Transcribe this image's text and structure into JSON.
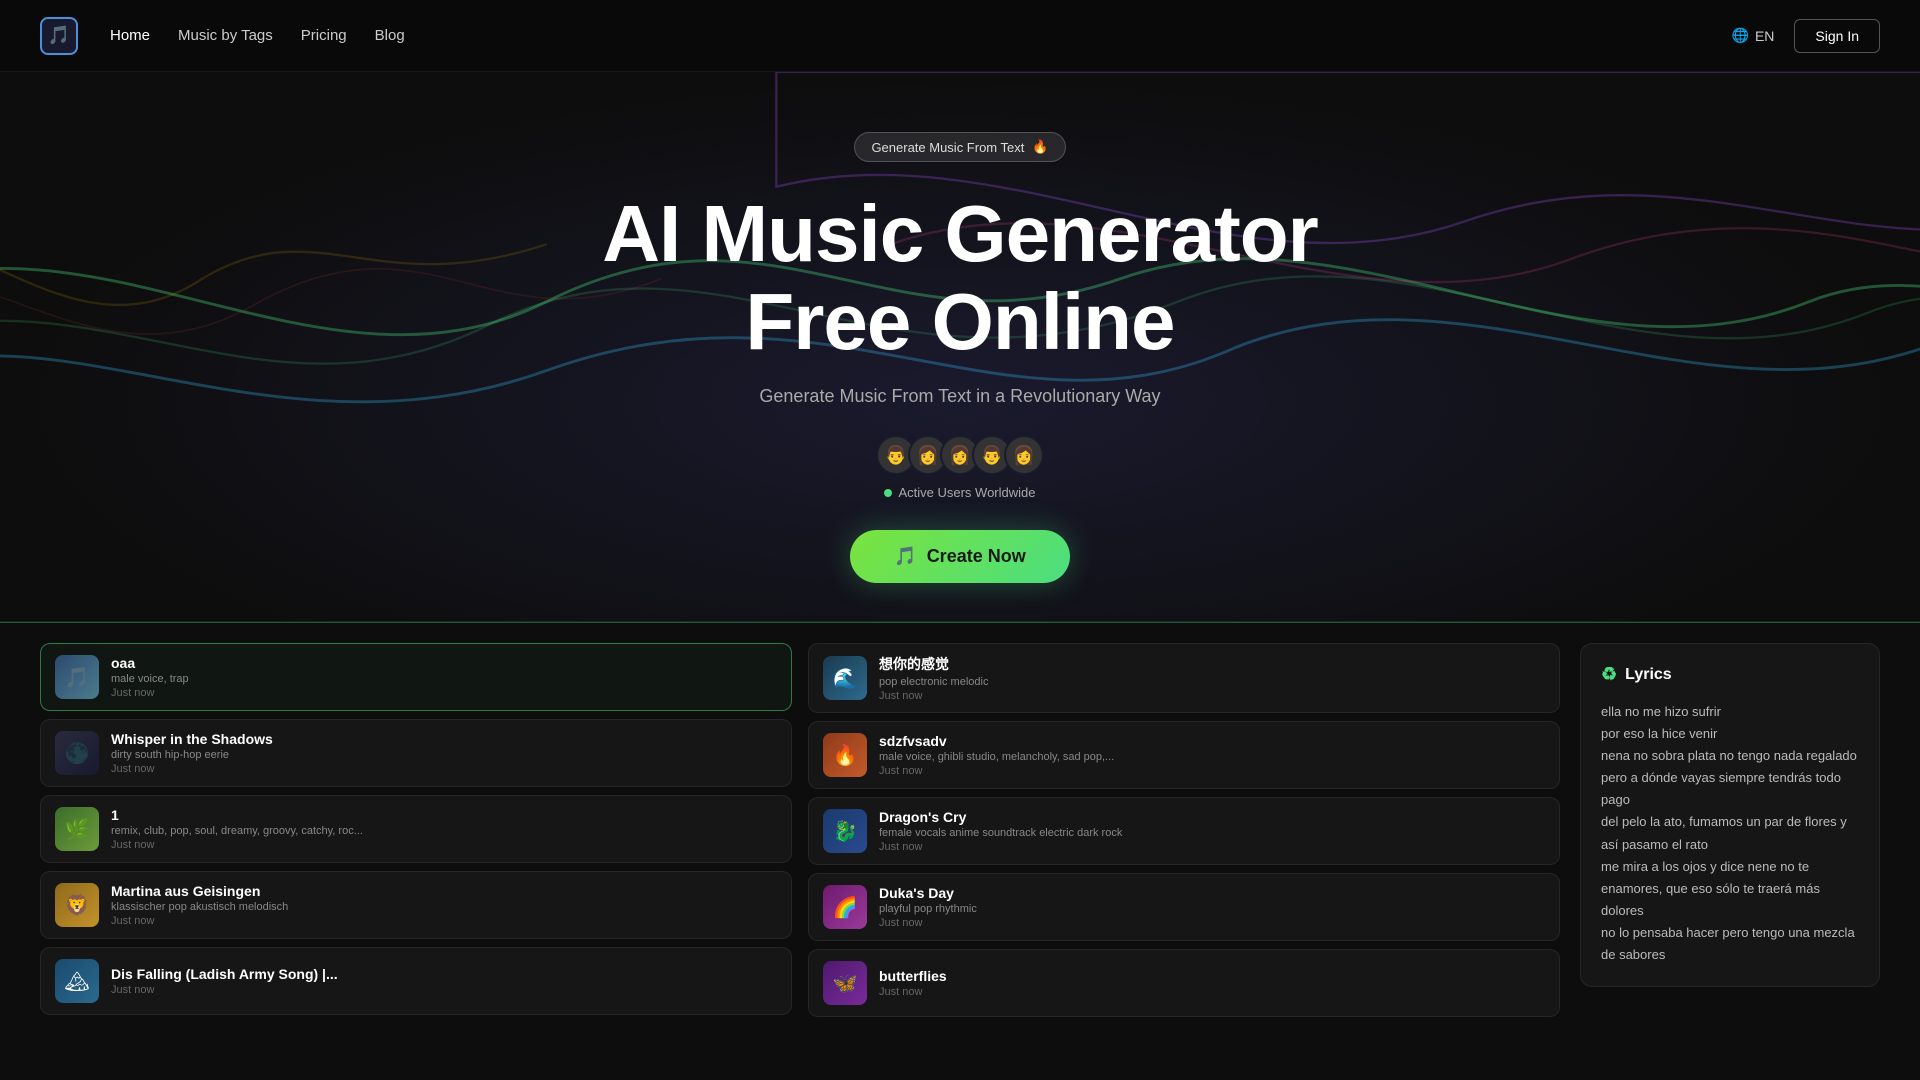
{
  "nav": {
    "logo_icon": "🎵",
    "links": [
      {
        "id": "home",
        "label": "Home",
        "active": true
      },
      {
        "id": "music-by-tags",
        "label": "Music by Tags",
        "active": false
      },
      {
        "id": "pricing",
        "label": "Pricing",
        "active": false
      },
      {
        "id": "blog",
        "label": "Blog",
        "active": false
      }
    ],
    "lang_label": "EN",
    "sign_in_label": "Sign In"
  },
  "hero": {
    "badge_text": "Generate Music From Text",
    "badge_icon": "🔥",
    "title_line1": "AI Music Generator",
    "title_line2": "Free Online",
    "subtitle": "Generate Music From Text in a Revolutionary Way",
    "active_users_label": "Active Users Worldwide",
    "create_btn_label": "Create Now",
    "create_btn_icon": "🎵"
  },
  "music_list_left": [
    {
      "id": "oaa",
      "name": "oaa",
      "tags": "male voice, trap",
      "time": "Just now",
      "thumb_emoji": "🎵",
      "thumb_class": "thumb-oaa",
      "selected": true
    },
    {
      "id": "whisper",
      "name": "Whisper in the Shadows",
      "tags": "dirty south hip-hop eerie",
      "time": "Just now",
      "thumb_emoji": "🌑",
      "thumb_class": "thumb-whisper",
      "selected": false
    },
    {
      "id": "one",
      "name": "1",
      "tags": "remix, club, pop, soul, dreamy, groovy, catchy, roc...",
      "time": "Just now",
      "thumb_emoji": "🌿",
      "thumb_class": "thumb-1",
      "selected": false
    },
    {
      "id": "martina",
      "name": "Martina aus Geisingen",
      "tags": "klassischer pop akustisch melodisch",
      "time": "Just now",
      "thumb_emoji": "🦁",
      "thumb_class": "thumb-martina",
      "selected": false
    },
    {
      "id": "dis",
      "name": "Dis Falling (Ladish Army Song) |...",
      "tags": "",
      "time": "Just now",
      "thumb_emoji": "🏔",
      "thumb_class": "thumb-dis",
      "selected": false
    }
  ],
  "music_list_right": [
    {
      "id": "xiangnide",
      "name": "想你的感觉",
      "tags": "pop electronic melodic",
      "time": "Just now",
      "thumb_emoji": "🌊",
      "thumb_class": "thumb-xiangnide",
      "selected": false
    },
    {
      "id": "sdzf",
      "name": "sdzfvsadv",
      "tags": "male voice, ghibli studio, melancholy, sad pop,...",
      "time": "Just now",
      "thumb_emoji": "🔥",
      "thumb_class": "thumb-sdzf",
      "selected": false
    },
    {
      "id": "dragon",
      "name": "Dragon's Cry",
      "tags": "female vocals anime soundtrack electric dark rock",
      "time": "Just now",
      "thumb_emoji": "🐉",
      "thumb_class": "thumb-dragon",
      "selected": false
    },
    {
      "id": "duka",
      "name": "Duka's Day",
      "tags": "playful pop rhythmic",
      "time": "Just now",
      "thumb_emoji": "🌈",
      "thumb_class": "thumb-duka",
      "selected": false
    },
    {
      "id": "butterflies",
      "name": "butterflies",
      "tags": "",
      "time": "Just now",
      "thumb_emoji": "🦋",
      "thumb_class": "thumb-butterflies",
      "selected": false
    }
  ],
  "lyrics": {
    "header": "Lyrics",
    "header_icon": "♻",
    "lines": [
      "ella no me hizo sufrir",
      "por eso la hice venir",
      "nena no sobra plata no tengo nada regalado",
      "pero a dónde vayas siempre tendrás todo pago",
      "del pelo la ato, fumamos un par de flores y así pasamo el rato",
      "me mira a los ojos y dice nene no te enamores, que eso sólo te traerá más dolores",
      "no lo pensaba hacer pero tengo una mezcla de sabores"
    ]
  },
  "avatars": [
    "👨",
    "👩",
    "👩",
    "👨",
    "👩"
  ]
}
